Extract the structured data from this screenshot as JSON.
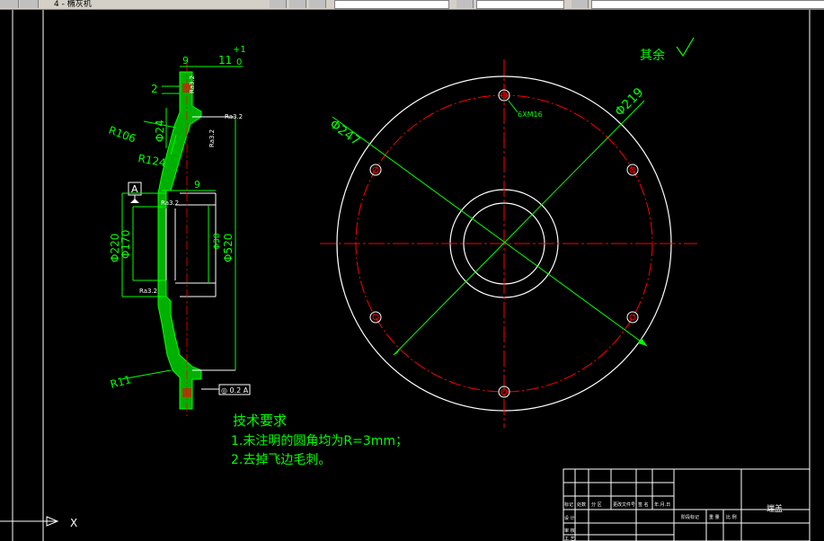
{
  "toolbar": {
    "title_label": "4 - 椭灰机",
    "icons": [
      "save-icon",
      "undo-icon",
      "layer-icon",
      "properties-icon",
      "color-icon"
    ]
  },
  "drawing": {
    "dims": {
      "top_width": "9",
      "top_total": "11",
      "tol_upper": "+1",
      "tol_lower": "0",
      "small_offset": "2",
      "r106": "R106",
      "r124": "R124",
      "d24": "Φ24",
      "d220": "Φ220",
      "d170": "Φ170",
      "d520": "Φ520",
      "d_small": "Φ38",
      "web": "9",
      "r11": "R11",
      "d247": "Φ247",
      "d219": "Φ219",
      "holes": "6XM16"
    },
    "roughness": {
      "r1": "Ra3.2",
      "r2": "Ra3.2",
      "r3": "Ra3.2",
      "r4": "Ra3.2",
      "r5": "Ra3.2"
    },
    "datum": "A",
    "tolerance_frame": "◎ 0.2 A",
    "rest_note": "其余",
    "requirements": {
      "title": "技术要求",
      "line1": "1.未注明的圆角均为R=3mm；",
      "line2": "2.去掉飞边毛刺。"
    },
    "title_block": {
      "part_name": "端盖",
      "row_labels": [
        "标记",
        "处数",
        "分 区",
        "更改文件号",
        "签 名",
        "年.月.日"
      ],
      "col_labels": [
        "设 计",
        "审 核",
        "工 艺"
      ],
      "stage_labels": [
        "阶段标记",
        "重 量",
        "比 例"
      ]
    }
  },
  "ucs": {
    "x_label": "X"
  },
  "colors": {
    "background": "#000000",
    "green": "#00ff00",
    "white": "#ffffff",
    "red": "#ff0000",
    "hatch": "#00c000"
  }
}
